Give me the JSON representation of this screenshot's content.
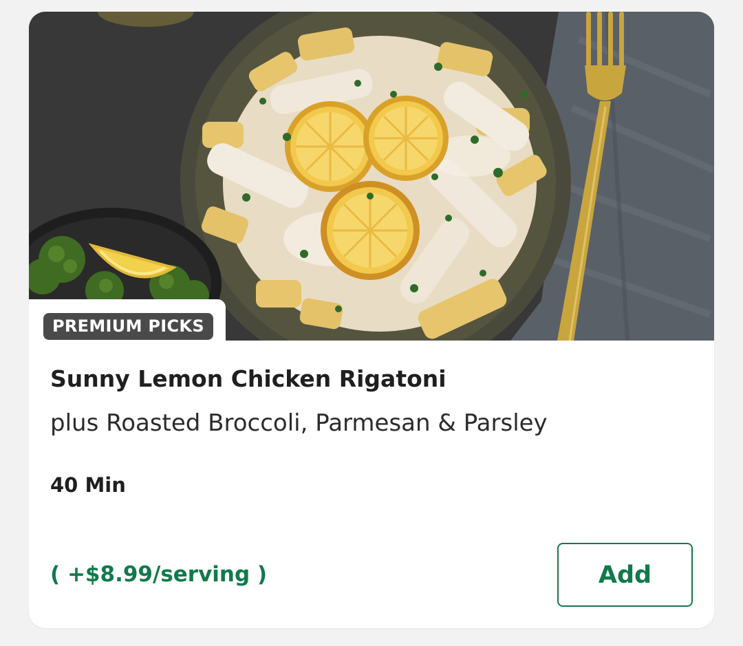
{
  "card": {
    "badge": "PREMIUM PICKS",
    "title": "Sunny Lemon Chicken Rigatoni",
    "subtitle": "plus Roasted Broccoli, Parmesan & Parsley",
    "time": "40 Min",
    "price": "( +$8.99/serving )",
    "add_label": "Add"
  },
  "colors": {
    "accent_green": "#117a4a",
    "badge_bg": "#4a4a4a",
    "background": "#f2f2f2"
  },
  "hero_image": {
    "icon": "recipe-photo",
    "depicts": "plate of rigatoni with chicken, lemon slices, cream sauce and parsley; bowl of broccoli with lemon wedge; gold fork on grey napkin"
  }
}
